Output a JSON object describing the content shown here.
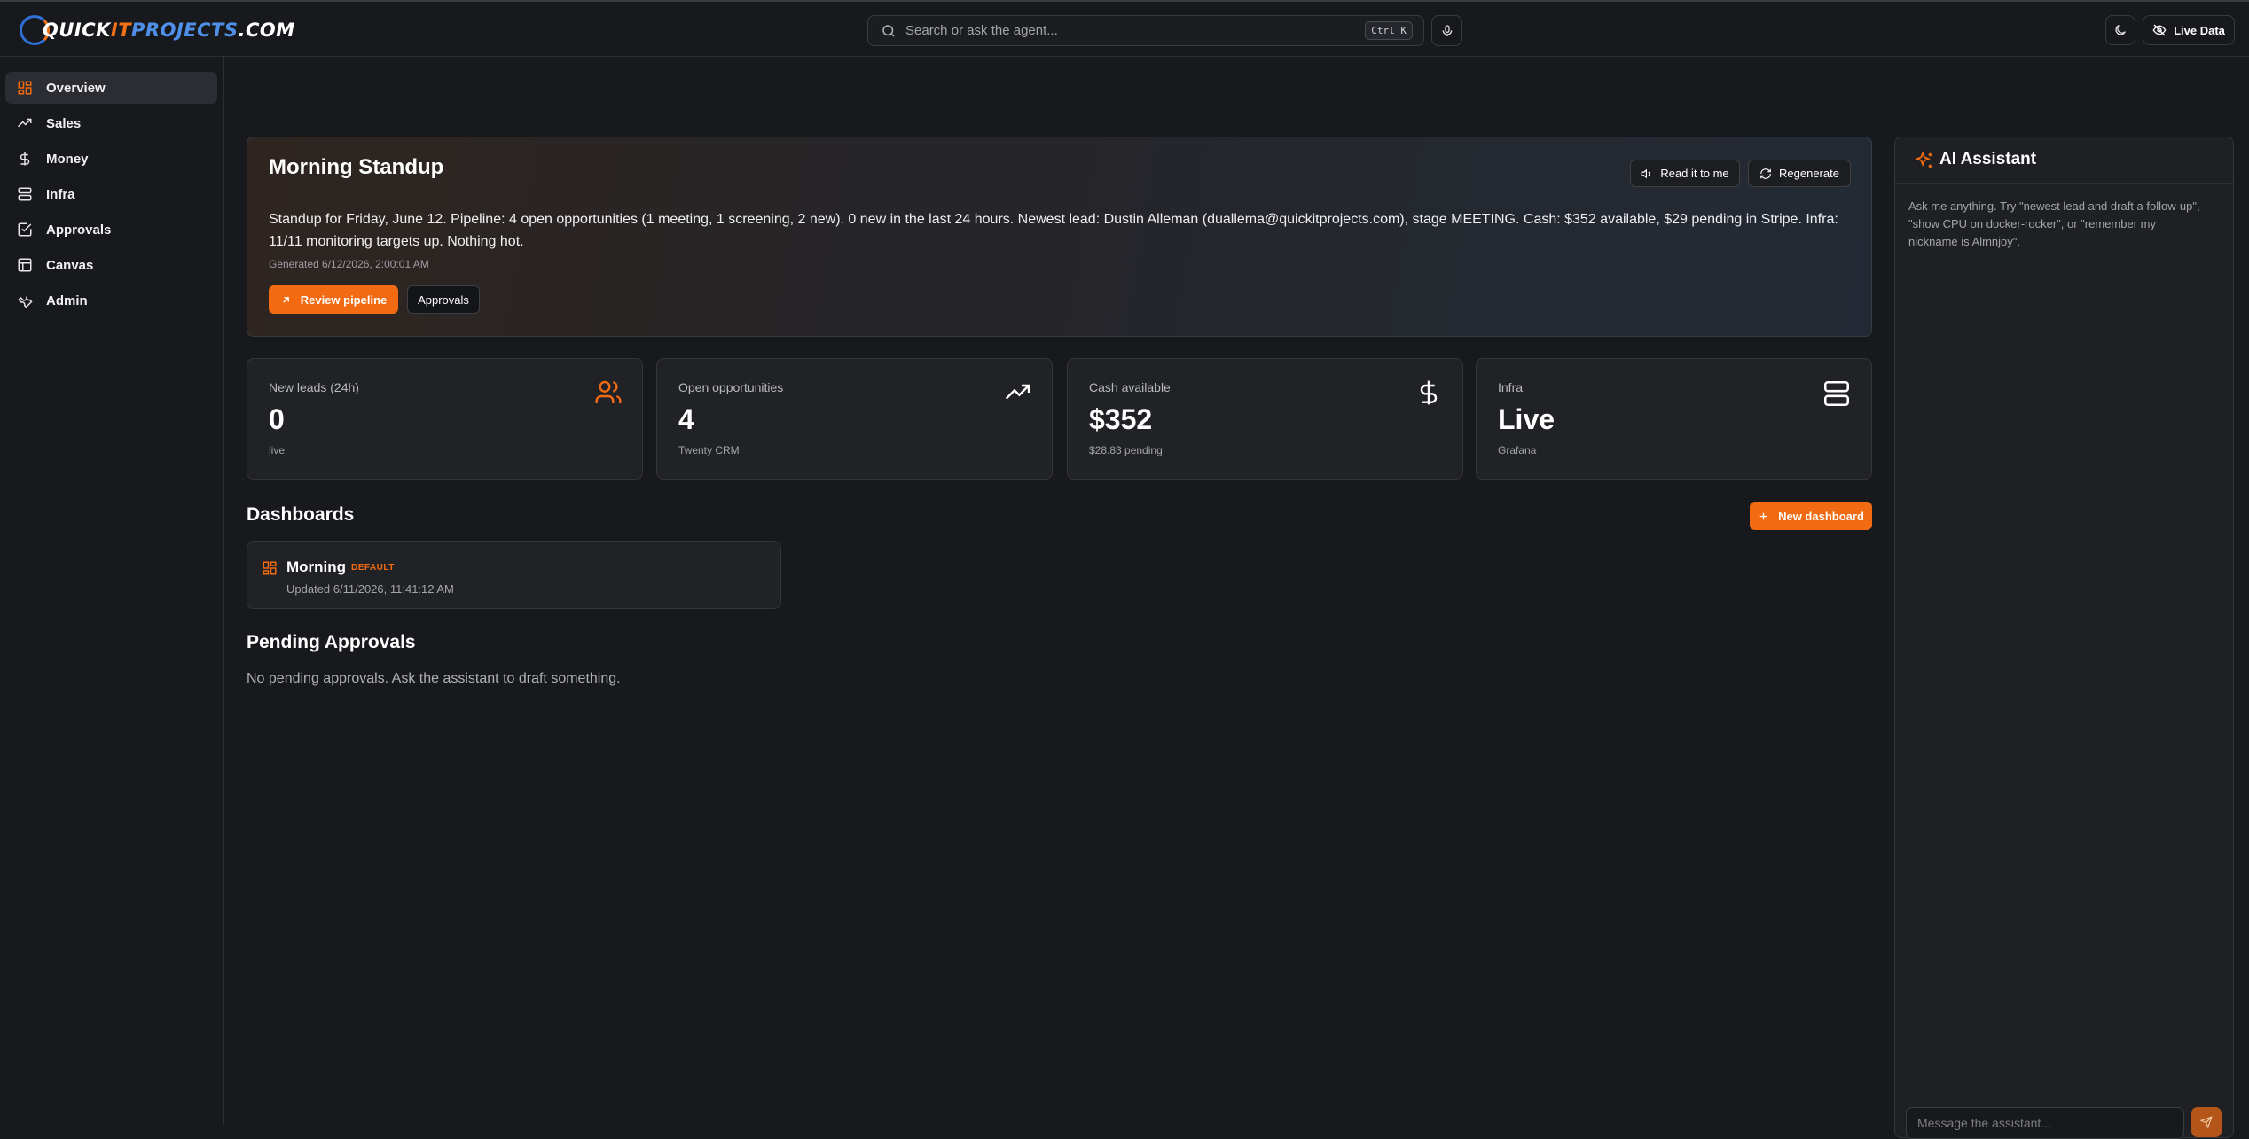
{
  "brand": {
    "part1": "QUICK",
    "part2": "IT",
    "part3": "PROJECTS",
    "part4": ".COM"
  },
  "header": {
    "search_placeholder": "Search or ask the agent...",
    "search_shortcut": "Ctrl K",
    "live_label": "Live Data"
  },
  "sidebar": {
    "items": [
      {
        "label": "Overview",
        "icon": "dashboard-icon",
        "active": true
      },
      {
        "label": "Sales",
        "icon": "trending-up-icon"
      },
      {
        "label": "Money",
        "icon": "dollar-icon"
      },
      {
        "label": "Infra",
        "icon": "server-icon"
      },
      {
        "label": "Approvals",
        "icon": "check-square-icon"
      },
      {
        "label": "Canvas",
        "icon": "layout-icon"
      },
      {
        "label": "Admin",
        "icon": "wrench-icon"
      }
    ]
  },
  "standup": {
    "title": "Morning Standup",
    "read_label": "Read it to me",
    "regen_label": "Regenerate",
    "text": "Standup for Friday, June 12. Pipeline: 4 open opportunities (1 meeting, 1 screening, 2 new). 0 new in the last 24 hours. Newest lead: Dustin Alleman (duallema@quickitprojects.com), stage MEETING. Cash: $352 available, $29 pending in Stripe. Infra: 11/11 monitoring targets up. Nothing hot.",
    "generated": "Generated 6/12/2026, 2:00:01 AM",
    "review_label": "Review pipeline",
    "approvals_label": "Approvals"
  },
  "stats": [
    {
      "label": "New leads (24h)",
      "value": "0",
      "sub": "live",
      "icon": "users-icon"
    },
    {
      "label": "Open opportunities",
      "value": "4",
      "sub": "Twenty CRM",
      "icon": "trending-up-icon"
    },
    {
      "label": "Cash available",
      "value": "$352",
      "sub": "$28.83 pending",
      "icon": "dollar-icon"
    },
    {
      "label": "Infra",
      "value": "Live",
      "sub": "Grafana",
      "icon": "server-icon"
    }
  ],
  "dashboards": {
    "title": "Dashboards",
    "new_label": "New dashboard",
    "items": [
      {
        "name": "Morning",
        "tag": "DEFAULT",
        "updated": "Updated 6/11/2026, 11:41:12 AM"
      }
    ]
  },
  "approvals": {
    "title": "Pending Approvals",
    "empty": "No pending approvals. Ask the assistant to draft something."
  },
  "assistant": {
    "title": "AI Assistant",
    "hint": "Ask me anything. Try \"newest lead and draft a follow-up\", \"show CPU on docker-rocker\", or \"remember my nickname is Almnjoy\".",
    "input_placeholder": "Message the assistant..."
  },
  "colors": {
    "accent": "#f26b12",
    "background": "#18191d",
    "card": "#212226"
  }
}
